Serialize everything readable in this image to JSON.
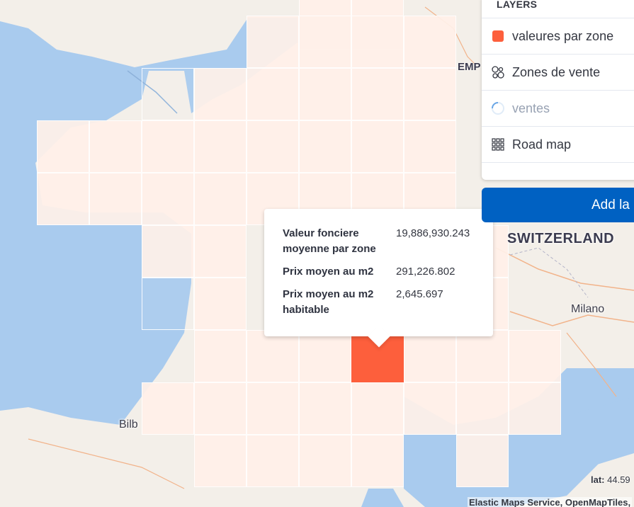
{
  "map": {
    "places": {
      "bilbao": "Bilb",
      "milano": "Milano",
      "switzerland": "SWITZERLAND",
      "emp": "EMP"
    },
    "highlight_color": "#fd5f3c"
  },
  "tooltip": {
    "rows": [
      {
        "label": "Valeur fonciere moyenne par zone",
        "value": "19,886,930.243"
      },
      {
        "label": "Prix moyen au m2",
        "value": "291,226.802"
      },
      {
        "label": "Prix moyen au m2 habitable",
        "value": "2,645.697"
      }
    ]
  },
  "layers_panel": {
    "title": "LAYERS",
    "items": [
      {
        "label": "valeures par zone",
        "icon": "filled-square-icon",
        "color": "#fd5f3c"
      },
      {
        "label": "Zones de vente",
        "icon": "cluster-circles-icon"
      },
      {
        "label": "ventes",
        "icon": "loading-spinner-icon"
      },
      {
        "label": "Road map",
        "icon": "grid-icon"
      }
    ],
    "add_button": "Add la"
  },
  "status": {
    "lat_label": "lat:",
    "lat_value": "44.59"
  },
  "attribution": "Elastic Maps Service, OpenMapTiles,"
}
